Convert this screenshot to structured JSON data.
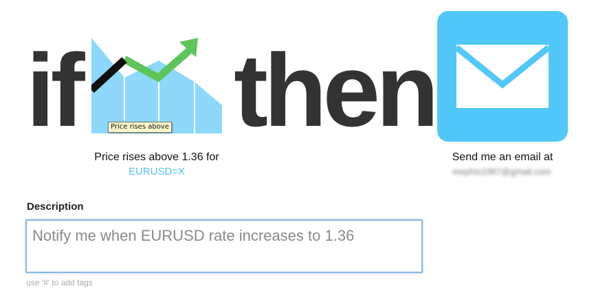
{
  "recipe": {
    "if_word": "if",
    "then_word": "then"
  },
  "trigger": {
    "icon": "price-rise-chart-icon",
    "tooltip": "Price rises above",
    "caption": "Price rises above 1.36 for",
    "symbol": "EURUSD=X",
    "colors": {
      "area": "#8dd8fb",
      "arrow": "#5cc65a",
      "line": "#111111",
      "link": "#55c2ee"
    }
  },
  "action": {
    "icon": "envelope-icon",
    "caption": "Send me an email at",
    "email": "mephis1987@gmail.com",
    "colors": {
      "tile": "#52c7f9"
    }
  },
  "description": {
    "label": "Description",
    "value": "",
    "placeholder": "Notify me when EURUSD rate increases to 1.36",
    "hint": "use '#' to add tags"
  }
}
